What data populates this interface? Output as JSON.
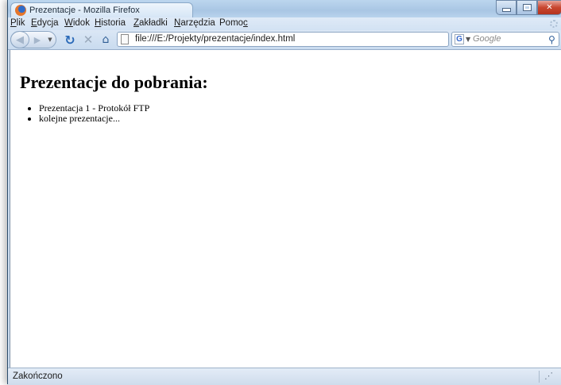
{
  "window": {
    "title": "Prezentacje - Mozilla Firefox"
  },
  "menu": {
    "items": [
      {
        "pre": "",
        "key": "P",
        "post": "lik"
      },
      {
        "pre": "",
        "key": "E",
        "post": "dycja"
      },
      {
        "pre": "",
        "key": "W",
        "post": "idok"
      },
      {
        "pre": "",
        "key": "H",
        "post": "istoria"
      },
      {
        "pre": "",
        "key": "Z",
        "post": "akładki"
      },
      {
        "pre": "",
        "key": "N",
        "post": "arzędzia"
      },
      {
        "pre": "Pomo",
        "key": "c",
        "post": ""
      }
    ]
  },
  "navbar": {
    "url": "file:///E:/Projekty/prezentacje/index.html",
    "search_placeholder": "Google",
    "search_engine_letter": "G"
  },
  "page": {
    "heading": "Prezentacje do pobrania:",
    "items": [
      "Prezentacja 1 - Protokół FTP",
      "kolejne prezentacje..."
    ]
  },
  "status": {
    "text": "Zakończono"
  },
  "colors": {
    "chrome": "#cfe0f2",
    "close_button": "#c8462f",
    "url_text": "#1d1d1d"
  }
}
